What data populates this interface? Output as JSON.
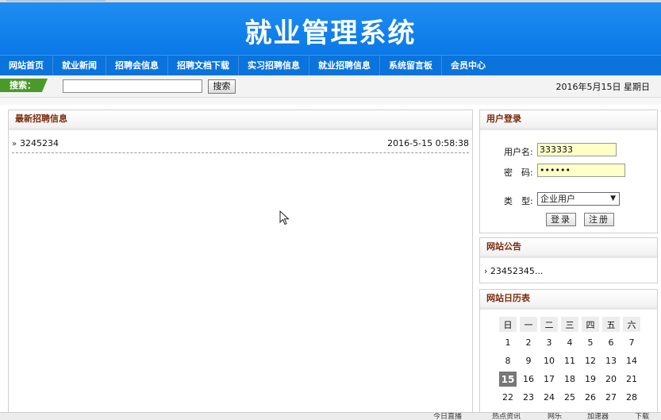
{
  "site": {
    "title": "就业管理系统"
  },
  "nav": {
    "items": [
      "网站首页",
      "就业新闻",
      "招聘会信息",
      "招聘文档下载",
      "实习招聘信息",
      "就业招聘信息",
      "系统留言板",
      "会员中心"
    ]
  },
  "search": {
    "label": "搜索：",
    "input_value": "",
    "button_label": "搜索",
    "date_text": "2016年5月15日 星期日"
  },
  "recruit": {
    "title": "最新招聘信息",
    "items": [
      {
        "title": "3245234",
        "date": "2016-5-15 0:58:38"
      }
    ]
  },
  "login": {
    "title": "用户登录",
    "username_label": "用户名:",
    "username_value": "333333",
    "password_label": "密　码:",
    "password_value": "••••••",
    "type_label": "类　型:",
    "type_value": "企业用户",
    "login_button": "登录",
    "register_button": "注册"
  },
  "notice": {
    "title": "网站公告",
    "items": [
      "23452345..."
    ]
  },
  "calendar": {
    "title": "网站日历表",
    "weekdays": [
      "日",
      "一",
      "二",
      "三",
      "四",
      "五",
      "六"
    ],
    "weeks": [
      [
        "1",
        "2",
        "3",
        "4",
        "5",
        "6",
        "7"
      ],
      [
        "8",
        "9",
        "10",
        "11",
        "12",
        "13",
        "14"
      ],
      [
        "15",
        "16",
        "17",
        "18",
        "19",
        "20",
        "21"
      ],
      [
        "22",
        "23",
        "24",
        "25",
        "26",
        "27",
        "28"
      ]
    ],
    "today": "15"
  },
  "statusbar": {
    "items": [
      "今日直播",
      "热点资讯",
      "网乐",
      "加速器",
      "下载"
    ]
  }
}
